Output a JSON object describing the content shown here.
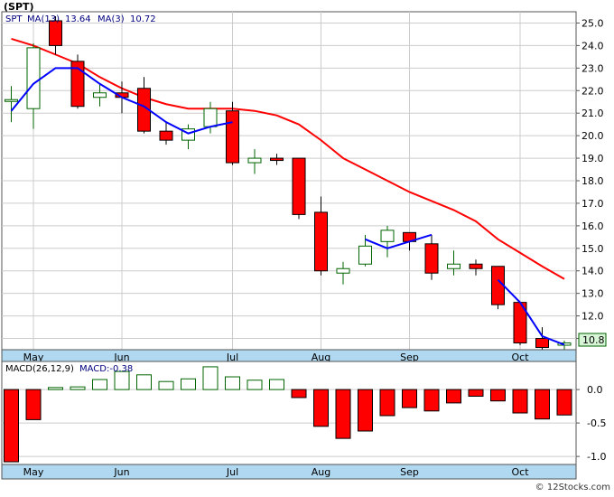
{
  "symbol_title": "(SPT)",
  "watermark": "© 12Stocks.com",
  "price_panel": {
    "symbol_label": "SPT",
    "ma13_label": "MA(13)",
    "ma13_value": "13.64",
    "ma3_label": "MA(3)",
    "ma3_value": "10.72",
    "last_price_badge": "10.8"
  },
  "macd_panel": {
    "label": "MACD(26,12,9)",
    "value_label": "MACD:-0.38"
  },
  "colors": {
    "bull_candle": "#006400",
    "bear_candle": "#ff0000",
    "ma13_line": "#ff0000",
    "ma3_line": "#0000ff",
    "axis_band": "#b0d8f0",
    "border": "#555555",
    "grid": "#cccccc"
  },
  "chart_data": [
    {
      "type": "candlestick",
      "ylim": [
        10.5,
        25.5
      ],
      "y_ticks": [
        11,
        12,
        13,
        14,
        15,
        16,
        17,
        18,
        19,
        20,
        21,
        22,
        23,
        24,
        25
      ],
      "y_tick_labels": [
        "11.0",
        "12.0",
        "13.0",
        "14.0",
        "15.0",
        "16.0",
        "17.0",
        "18.0",
        "19.0",
        "20.0",
        "21.0",
        "22.0",
        "23.0",
        "24.0",
        "25.0"
      ],
      "x_month_labels": [
        {
          "label": "May",
          "index": 1
        },
        {
          "label": "Jun",
          "index": 5
        },
        {
          "label": "Jul",
          "index": 10
        },
        {
          "label": "Aug",
          "index": 14
        },
        {
          "label": "Sep",
          "index": 18
        },
        {
          "label": "Oct",
          "index": 23
        }
      ],
      "candles": [
        {
          "o": 21.6,
          "h": 22.2,
          "l": 20.6,
          "c": 21.6
        },
        {
          "o": 21.2,
          "h": 24.1,
          "l": 20.3,
          "c": 23.9
        },
        {
          "o": 25.1,
          "h": 25.3,
          "l": 23.6,
          "c": 24.0
        },
        {
          "o": 23.3,
          "h": 23.6,
          "l": 21.2,
          "c": 21.3
        },
        {
          "o": 21.7,
          "h": 22.3,
          "l": 21.3,
          "c": 21.9
        },
        {
          "o": 21.9,
          "h": 22.4,
          "l": 21.0,
          "c": 21.7
        },
        {
          "o": 22.1,
          "h": 22.6,
          "l": 20.1,
          "c": 20.2
        },
        {
          "o": 20.2,
          "h": 20.6,
          "l": 19.6,
          "c": 19.8
        },
        {
          "o": 19.8,
          "h": 20.5,
          "l": 19.4,
          "c": 20.3
        },
        {
          "o": 20.4,
          "h": 21.5,
          "l": 20.1,
          "c": 21.2
        },
        {
          "o": 21.1,
          "h": 21.5,
          "l": 18.7,
          "c": 18.8
        },
        {
          "o": 18.8,
          "h": 19.4,
          "l": 18.3,
          "c": 19.0
        },
        {
          "o": 19.0,
          "h": 19.2,
          "l": 18.7,
          "c": 18.9
        },
        {
          "o": 19.0,
          "h": 19.0,
          "l": 16.3,
          "c": 16.5
        },
        {
          "o": 16.6,
          "h": 17.3,
          "l": 13.8,
          "c": 14.0
        },
        {
          "o": 13.9,
          "h": 14.4,
          "l": 13.4,
          "c": 14.1
        },
        {
          "o": 14.3,
          "h": 15.6,
          "l": 14.2,
          "c": 15.1
        },
        {
          "o": 15.3,
          "h": 16.0,
          "l": 14.6,
          "c": 15.8
        },
        {
          "o": 15.7,
          "h": 15.7,
          "l": 14.9,
          "c": 15.3
        },
        {
          "o": 15.2,
          "h": 15.6,
          "l": 13.6,
          "c": 13.9
        },
        {
          "o": 14.1,
          "h": 14.9,
          "l": 13.8,
          "c": 14.3
        },
        {
          "o": 14.3,
          "h": 14.5,
          "l": 13.8,
          "c": 14.1
        },
        {
          "o": 14.2,
          "h": 14.2,
          "l": 12.3,
          "c": 12.5
        },
        {
          "o": 12.6,
          "h": 12.6,
          "l": 10.7,
          "c": 10.8
        },
        {
          "o": 11.0,
          "h": 11.5,
          "l": 10.5,
          "c": 10.6
        },
        {
          "o": 10.7,
          "h": 10.9,
          "l": 10.4,
          "c": 10.8
        }
      ],
      "ma13": {
        "start_index": 0,
        "values": [
          24.3,
          24.0,
          23.6,
          23.2,
          22.6,
          22.1,
          21.7,
          21.4,
          21.2,
          21.2,
          21.2,
          21.1,
          20.9,
          20.5,
          19.8,
          19.0,
          18.5,
          18.0,
          17.5,
          17.1,
          16.7,
          16.2,
          15.4,
          14.8,
          14.2,
          13.64
        ]
      },
      "ma3": {
        "start_index": 0,
        "values": [
          21.1,
          22.3,
          23.0,
          23.0,
          22.3,
          21.7,
          21.3,
          20.6,
          20.1,
          20.4,
          20.6,
          null,
          null,
          null,
          null,
          null,
          15.4,
          15.0,
          15.3,
          15.6,
          null,
          null,
          13.6,
          12.6,
          11.1,
          10.72
        ]
      }
    },
    {
      "type": "bar",
      "ylim": [
        -1.12,
        0.42
      ],
      "y_ticks": [
        0.0,
        -0.5,
        -1.0
      ],
      "y_tick_labels": [
        "0.0",
        "-0.5",
        "-1.0"
      ],
      "values": [
        -1.08,
        -0.45,
        0.03,
        0.04,
        0.15,
        0.27,
        0.22,
        0.12,
        0.16,
        0.34,
        0.19,
        0.14,
        0.15,
        -0.12,
        -0.55,
        -0.73,
        -0.62,
        -0.39,
        -0.27,
        -0.32,
        -0.2,
        -0.1,
        -0.17,
        -0.35,
        -0.44,
        -0.38
      ]
    }
  ]
}
